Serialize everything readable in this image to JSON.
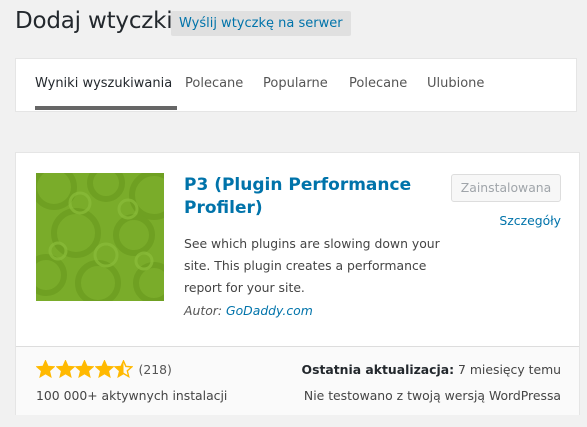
{
  "header": {
    "title": "Dodaj wtyczki",
    "upload_label": "Wyślij wtyczkę na serwer"
  },
  "tabs": [
    {
      "label": "Wyniki wyszukiwania",
      "active": true
    },
    {
      "label": "Polecane"
    },
    {
      "label": "Popularne"
    },
    {
      "label": "Polecane"
    },
    {
      "label": "Ulubione"
    }
  ],
  "plugin": {
    "name": "P3 (Plugin Performance Profiler)",
    "description": "See which plugins are slowing down your site. This plugin creates a performance report for your site.",
    "author_label": "Autor:",
    "author_name": "GoDaddy.com",
    "action_label": "Zainstalowana",
    "details_label": "Szczegóły",
    "rating_stars": 4.5,
    "rating_count": "(218)",
    "installs": "100 000+ aktywnych instalacji",
    "last_updated_label": "Ostatnia aktualizacja:",
    "last_updated_value": "7 miesięcy temu",
    "compatibility": "Nie testowano z twoją wersją WordPressa"
  },
  "colors": {
    "accent": "#0073aa",
    "star": "#ffb900",
    "icon_bg": "#7aac2a"
  },
  "icons": {
    "star_full": "star-icon",
    "star_half": "star-half-icon"
  }
}
